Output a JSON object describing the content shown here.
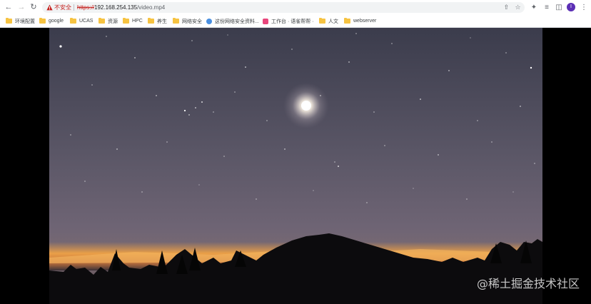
{
  "browser": {
    "not_secure_label": "不安全",
    "url_scheme": "https://",
    "url_host": "192.168.254.135",
    "url_path": "/video.mp4",
    "avatar_letter": "I",
    "accent_color": "#5b2fb5"
  },
  "bookmarks": [
    {
      "label": "环境配置",
      "icon": "folder-icon"
    },
    {
      "label": "google",
      "icon": "folder-icon"
    },
    {
      "label": "UCAS",
      "icon": "folder-icon"
    },
    {
      "label": "资源",
      "icon": "folder-icon"
    },
    {
      "label": "HPC",
      "icon": "folder-icon"
    },
    {
      "label": "养生",
      "icon": "folder-icon"
    },
    {
      "label": "网络安全",
      "icon": "folder-icon"
    },
    {
      "label": "这份网络安全资料...",
      "icon": "globe-icon"
    },
    {
      "label": "工作台 · 语雀帮帮 ·",
      "icon": "app-icon"
    },
    {
      "label": "人文",
      "icon": "folder-icon"
    },
    {
      "label": "webserver",
      "icon": "folder-icon"
    }
  ],
  "video": {
    "watermark": "@稀土掘金技术社区"
  }
}
